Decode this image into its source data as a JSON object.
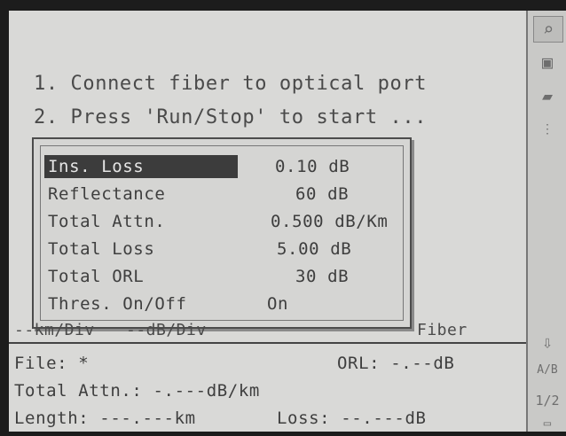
{
  "instructions": {
    "line1": "1. Connect fiber to optical port",
    "line2": "2. Press 'Run/Stop' to start ..."
  },
  "settings_dialog": {
    "rows": [
      {
        "label": "Ins. Loss",
        "value": "0.10 dB"
      },
      {
        "label": "Reflectance",
        "value": "60 dB"
      },
      {
        "label": "Total Attn.",
        "value": "0.500 dB/Km"
      },
      {
        "label": "Total Loss",
        "value": "5.00 dB"
      },
      {
        "label": "Total ORL",
        "value": "30 dB"
      },
      {
        "label": "Thres. On/Off",
        "value": "On"
      }
    ]
  },
  "trace_axis": {
    "km_div": "--km/Div",
    "db_div": "--dB/Div",
    "fiber": "Fiber"
  },
  "info_panel": {
    "file_label": "File: *",
    "orl_label": "ORL: -.--dB",
    "total_attn": "Total Attn.: -.---dB/km",
    "length": "Length: ---.---km",
    "loss": "Loss: --.---dB"
  },
  "sidebar": {
    "icons": [
      "search-icon",
      "save-icon",
      "open-folder-icon"
    ],
    "page": "1/2"
  }
}
